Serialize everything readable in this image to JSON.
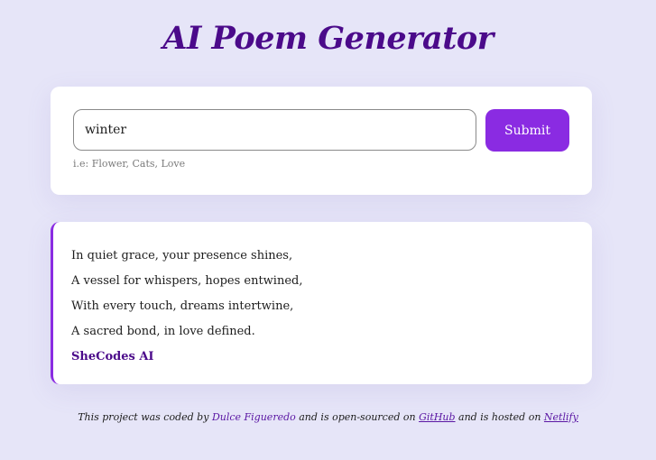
{
  "header": {
    "title": "AI Poem Generator"
  },
  "form": {
    "input_value": "winter",
    "submit_label": "Submit",
    "hint": "i.e: Flower, Cats, Love"
  },
  "poem": {
    "lines": [
      "In quiet grace, your presence shines,",
      "A vessel for whispers, hopes entwined,",
      "With every touch, dreams intertwine,",
      "A sacred bond, in love defined."
    ],
    "signature": "SheCodes AI"
  },
  "footer": {
    "text_1": "This project was coded by ",
    "author": "Dulce Figueredo",
    "text_2": " and is open-sourced on ",
    "github": "GitHub",
    "text_3": " and is hosted on ",
    "netlify": "Netlify"
  },
  "colors": {
    "accent": "#8a2be2",
    "title": "#4b0a8a",
    "background": "#e6e5f8"
  }
}
